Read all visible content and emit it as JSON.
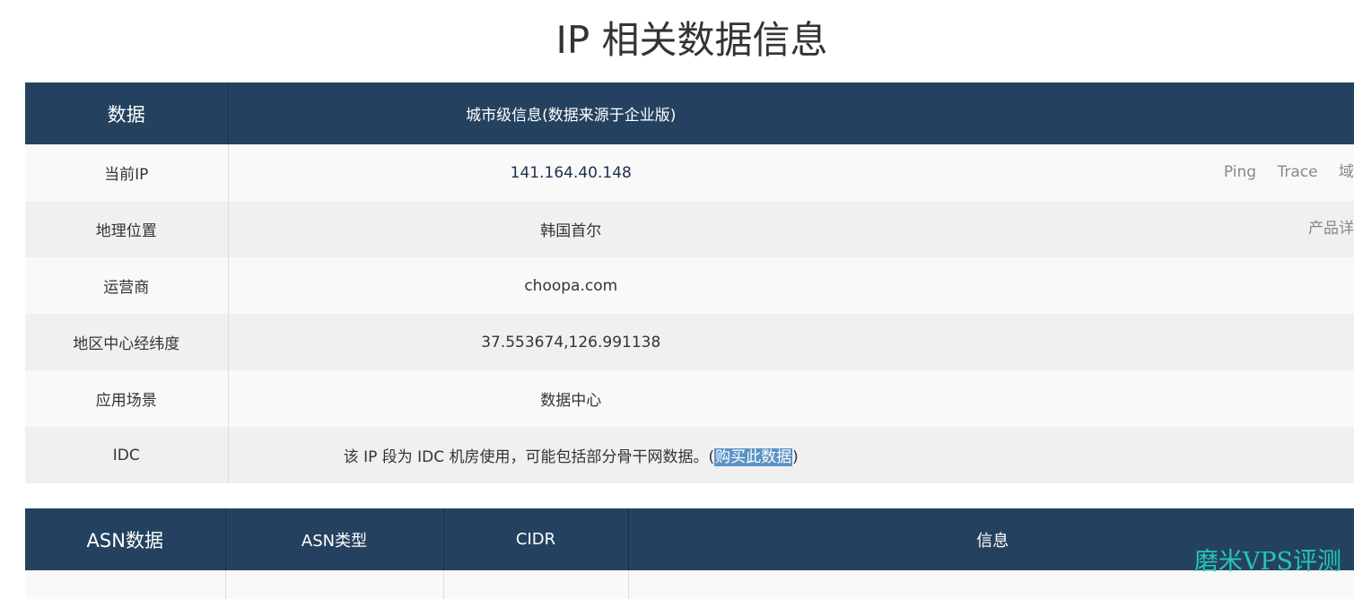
{
  "page": {
    "title": "IP 相关数据信息"
  },
  "info_table": {
    "header": {
      "col1": "数据",
      "col2": "城市级信息(数据来源于企业版)"
    },
    "rows": [
      {
        "label": "当前IP",
        "value": "141.164.40.148"
      },
      {
        "label": "地理位置",
        "value": "韩国首尔"
      },
      {
        "label": "运营商",
        "value": "choopa.com"
      },
      {
        "label": "地区中心经纬度",
        "value": "37.553674,126.991138"
      },
      {
        "label": "应用场景",
        "value": "数据中心"
      },
      {
        "label": "IDC",
        "value_prefix": "该 IP 段为 IDC 机房使用，可能包括部分骨干网数据。(",
        "link": "购买此数据",
        "value_suffix": ")"
      }
    ],
    "ip_links": {
      "ping": "Ping",
      "trace": "Trace",
      "domain": "域名"
    },
    "location_link": "产品详情"
  },
  "asn_table": {
    "header": {
      "col1": "ASN数据",
      "col2": "ASN类型",
      "col3": "CIDR",
      "col4": "信息"
    }
  },
  "watermark": "磨米VPS评测",
  "colors": {
    "header_bg": "#244260",
    "row_odd": "#f9f9f9",
    "row_even": "#f0f0f0",
    "link_highlight": "#5b93c5",
    "watermark": "#25c6b8"
  }
}
